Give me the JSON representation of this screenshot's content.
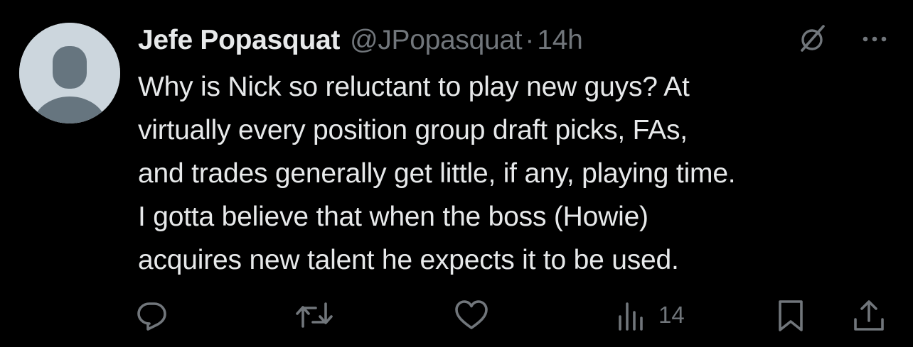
{
  "author": {
    "display_name": "Jefe Popasquat",
    "handle": "@JPopasquat",
    "separator": "·",
    "time": "14h",
    "avatar_icon": "default-avatar-icon"
  },
  "tweet": {
    "text": "Why is Nick so reluctant to play new guys?  At\nvirtually every position group draft picks, FAs,\nand trades generally get little, if any, playing time.\nI gotta believe that when the boss (Howie)\nacquires new talent he expects it to be used."
  },
  "header_icons": [
    "grok-icon",
    "more-icon"
  ],
  "actions": {
    "reply_icon": "reply-icon",
    "retweet_icon": "retweet-icon",
    "like_icon": "like-icon",
    "views_icon": "views-icon",
    "views_count": "14",
    "bookmark_icon": "bookmark-icon",
    "share_icon": "share-icon"
  },
  "colors": {
    "background": "#000000",
    "primary_text": "#e7e9ea",
    "secondary_text": "#71767b",
    "avatar_bg": "#ccd6dd",
    "avatar_figure": "#66757f"
  }
}
